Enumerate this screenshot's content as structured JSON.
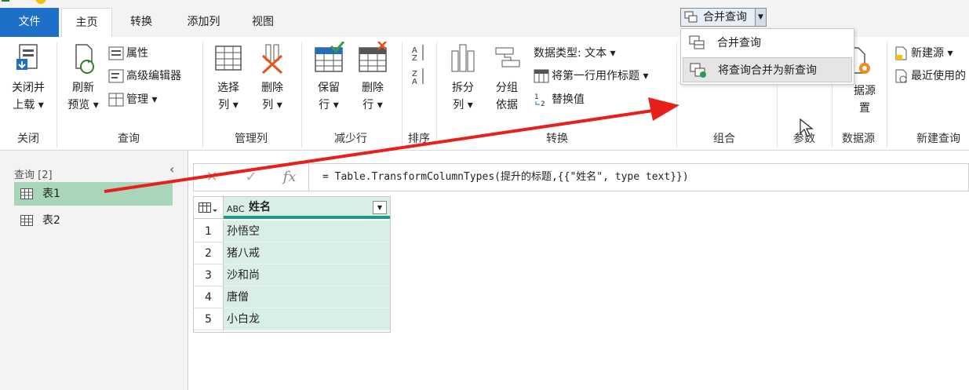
{
  "tabs": [
    "文件",
    "主页",
    "转换",
    "添加列",
    "视图"
  ],
  "ribbon": {
    "close": {
      "label_line1": "关闭并",
      "label_line2": "上载",
      "group": "关闭"
    },
    "query": {
      "refresh_line1": "刷新",
      "refresh_line2": "预览",
      "properties": "属性",
      "advanced_editor": "高级编辑器",
      "manage": "管理",
      "group": "查询"
    },
    "manage_columns": {
      "choose_line1": "选择",
      "choose_line2": "列",
      "remove_line1": "删除",
      "remove_line2": "列",
      "group": "管理列"
    },
    "reduce_rows": {
      "keep_line1": "保留",
      "keep_line2": "行",
      "remove_line1": "删除",
      "remove_line2": "行",
      "group": "减少行"
    },
    "sort": {
      "group": "排序"
    },
    "transform": {
      "split_line1": "拆分",
      "split_line2": "列",
      "groupby_line1": "分组",
      "groupby_line2": "依据",
      "datatype": "数据类型: 文本",
      "use_first_row": "将第一行用作标题",
      "replace_values": "替换值",
      "group": "转换"
    },
    "combine": {
      "merge_queries": "合并查询",
      "group": "组合"
    },
    "params": {
      "group": "参数"
    },
    "datasource": {
      "label_fragment_1": "据源",
      "label_fragment_2": "置",
      "group": "数据源"
    },
    "new_query": {
      "new_source": "新建源",
      "recent_sources": "最近使用的",
      "group": "新建查询"
    }
  },
  "dropdown": {
    "items": [
      "合并查询",
      "将查询合并为新查询"
    ]
  },
  "queries_pane": {
    "header": "查询 [2]",
    "items": [
      "表1",
      "表2"
    ],
    "selected_index": 0
  },
  "formula_bar": {
    "formula": "= Table.TransformColumnTypes(提升的标题,{{\"姓名\", type text}})"
  },
  "table": {
    "column_header": "姓名",
    "column_type_icon": "ABC",
    "rows": [
      {
        "num": "1",
        "value": "孙悟空"
      },
      {
        "num": "2",
        "value": "猪八戒"
      },
      {
        "num": "3",
        "value": "沙和尚"
      },
      {
        "num": "4",
        "value": "唐僧"
      },
      {
        "num": "5",
        "value": "小白龙"
      }
    ]
  },
  "colors": {
    "file_tab": "#1e6fc8",
    "selected_query": "#a9d6b8",
    "column_fill": "#d9efe5",
    "column_accent": "#1a9a8a",
    "annotation_arrow": "#e8201c"
  }
}
